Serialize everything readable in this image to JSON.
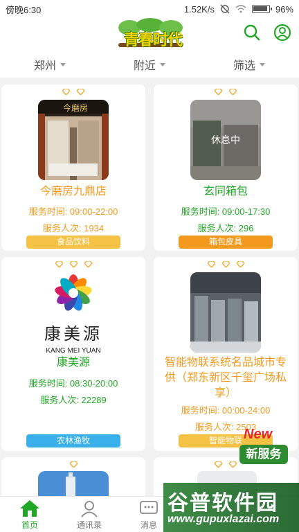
{
  "status": {
    "time": "傍晚6:30",
    "speed": "1.52K/s",
    "battery": "96%"
  },
  "header": {
    "logo_text": "青春时代"
  },
  "filters": [
    {
      "label": "郑州"
    },
    {
      "label": "附近"
    },
    {
      "label": "筛选"
    }
  ],
  "cards": [
    {
      "title": "今磨房九鼎店",
      "hours": "服务时间: 09:00-22:00",
      "served": "服务人次: 1934",
      "category": "食品饮料",
      "category_color": "#f5c245",
      "text_color": "#f39a1e",
      "store_sign": "今磨房"
    },
    {
      "title": "玄同箱包",
      "hours": "服务时间: 09:00-17:30",
      "served": "服务人次: 296",
      "category": "箱包皮具",
      "category_color": "#f39a1e",
      "text_color": "#22a626",
      "overlay": "休息中"
    },
    {
      "title": "康美源",
      "hours": "服务时间: 08:30-20:00",
      "served": "服务人次: 22289",
      "category": "农林渔牧",
      "category_color": "#3ab0ea",
      "text_color": "#22a626",
      "logo_cn": "康美源",
      "logo_en": "KANG MEI YUAN"
    },
    {
      "title": "智能物联系统名品城市专供（郑东新区千玺广场私享）",
      "hours": "服务时间: 00:00-24:00",
      "served": "服务人次: 2503",
      "category": "智能物联",
      "category_color": "#f5c245",
      "text_color": "#f39a1e"
    }
  ],
  "tabs": [
    {
      "label": "首页"
    },
    {
      "label": "通讯录"
    },
    {
      "label": "消息"
    }
  ],
  "watermark": {
    "new": "New",
    "new_service": "新服务",
    "brand": "谷普软件园",
    "url": "www.gupuxlazai.com"
  },
  "colors": {
    "green": "#22a626",
    "orange": "#f39a1e",
    "diamond": "#f5a623"
  }
}
